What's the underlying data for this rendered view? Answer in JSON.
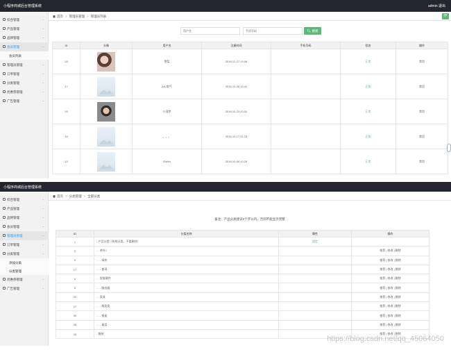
{
  "shot1": {
    "app_title": "小程序商城后台管理系统",
    "user": "admin  退出",
    "sidebar": [
      {
        "label": "综合管理"
      },
      {
        "label": "产品管理"
      },
      {
        "label": "品牌管理"
      },
      {
        "label": "会员管理",
        "active": true
      },
      {
        "label": "会员列表",
        "sub": true
      },
      {
        "label": "管理员管理"
      },
      {
        "label": "订单管理"
      },
      {
        "label": "分类管理"
      },
      {
        "label": "优惠券管理"
      },
      {
        "label": "广告管理"
      }
    ],
    "breadcrumb": [
      "首页",
      "管理员管理",
      "管理员列表"
    ],
    "refresh_icon": "refresh-icon",
    "filters": {
      "username_placeholder": "用户名",
      "phone_placeholder": "手机号码",
      "search_label": "搜索"
    },
    "table": {
      "headers": [
        "ID",
        "头像",
        "用户名",
        "注册时间",
        "手机号码",
        "状态",
        "操作"
      ],
      "rows": [
        {
          "id": "18",
          "avatar": "photo1",
          "username": "雪梨",
          "time": "2018-12-27 15:08",
          "phone": "",
          "status": "正常",
          "op": "禁用"
        },
        {
          "id": "17",
          "avatar": "placeholder",
          "username": "AA-斯气",
          "time": "2018-10-26 15:41",
          "phone": "",
          "status": "正常",
          "op": "禁用"
        },
        {
          "id": "16",
          "avatar": "photo2",
          "username": "小涛梦",
          "time": "2018-10-23 20:51",
          "phone": "",
          "status": "正常",
          "op": "禁用"
        },
        {
          "id": "15",
          "avatar": "placeholder",
          "username": "。。。",
          "time": "2018-10-17 21:13",
          "phone": "",
          "status": "正常",
          "op": "禁用"
        },
        {
          "id": "14",
          "avatar": "placeholder",
          "username": "Robin",
          "time": "2018-10-08 10:29",
          "phone": "",
          "status": "正常",
          "op": "禁用"
        }
      ]
    }
  },
  "shot2": {
    "app_title": "小程序商城后台管理系统",
    "sidebar": [
      {
        "label": "综合管理"
      },
      {
        "label": "产品管理"
      },
      {
        "label": "品牌管理"
      },
      {
        "label": "会员管理"
      },
      {
        "label": "管理员管理",
        "active": true
      },
      {
        "label": "订单管理"
      },
      {
        "label": "分类管理"
      },
      {
        "label": "添加分类",
        "sub": true
      },
      {
        "label": "分类管理",
        "sub": true
      },
      {
        "label": "优惠券管理"
      },
      {
        "label": "广告管理"
      }
    ],
    "breadcrumb": [
      "首页",
      "分类管理",
      "全部分类"
    ],
    "notice": "备注：产品分类建议5个字以内，否则不能显示完整",
    "table": {
      "headers": [
        "ID",
        "分类名称",
        "属性",
        "操作"
      ],
      "rows": [
        {
          "id": "1",
          "name": "- 产品分类（系统分类，不要删除）",
          "attr": "固定",
          "ops": ""
        },
        {
          "id": "3",
          "name": "- - 茶叶1",
          "attr": "",
          "ops": "推荐 | 修改 | 删除"
        },
        {
          "id": "9",
          "name": "- - - 绿茶",
          "attr": "",
          "ops": "推荐 | 修改 | 删除"
        },
        {
          "id": "17",
          "name": "- - - 普洱",
          "attr": "",
          "ops": "推荐 | 修改 | 删除"
        },
        {
          "id": "4",
          "name": "- - 智能硬件",
          "attr": "",
          "ops": "推荐 | 修改 | 删除"
        },
        {
          "id": "5",
          "name": "- - - 路由器",
          "attr": "",
          "ops": "推荐 | 修改 | 删除"
        },
        {
          "id": "20",
          "name": "- - 家具",
          "attr": "",
          "ops": "推荐 | 修改 | 删除"
        },
        {
          "id": "27",
          "name": "- - - 格类类",
          "attr": "",
          "ops": "推荐 | 修改 | 删除"
        },
        {
          "id": "39",
          "name": "- - - 餐桌",
          "attr": "",
          "ops": "推荐 | 修改 | 删除"
        },
        {
          "id": "38",
          "name": "- - - 桌类",
          "attr": "",
          "ops": "推荐 | 修改 | 删除"
        },
        {
          "id": "40",
          "name": "- 服装",
          "attr": "",
          "ops": "推荐 | 修改 | 删除"
        }
      ]
    }
  },
  "watermark": "https://blog.csdn.net/qq_45064050"
}
